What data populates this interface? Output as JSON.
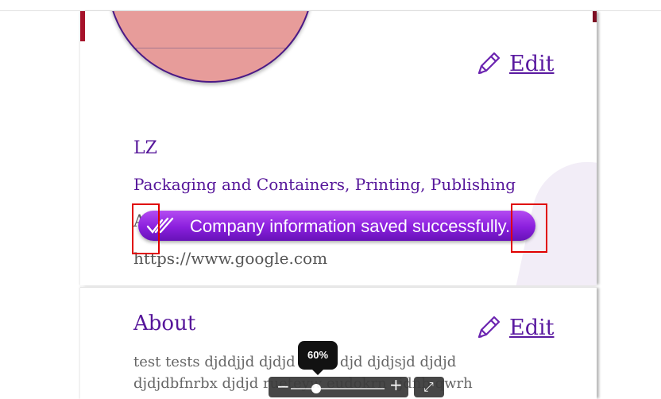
{
  "profile": {
    "edit_label": "Edit",
    "company_name": "LZ",
    "industry": "Packaging and Containers, Printing, Publishing",
    "address_partial": "A",
    "website": "https://www.google.com"
  },
  "toast": {
    "message": "Company information saved successfully.",
    "icon": "double-check-icon",
    "gradient_from": "#b44bf1",
    "gradient_to": "#6712b8"
  },
  "about": {
    "title": "About",
    "edit_label": "Edit",
    "text": "test tests djddjjd djdjd dsssj djd djdjsjd djdjd djdjdbfnrbx djdjd rueteyw eudokrn sjdnb qwrh"
  },
  "zoom": {
    "tooltip": "60%",
    "value_percent": 60,
    "minus_label": "−",
    "plus_label": "+"
  },
  "colors": {
    "brand_purple": "#56169a",
    "accent_red": "#a6122a",
    "highlight_red": "#e00000"
  }
}
